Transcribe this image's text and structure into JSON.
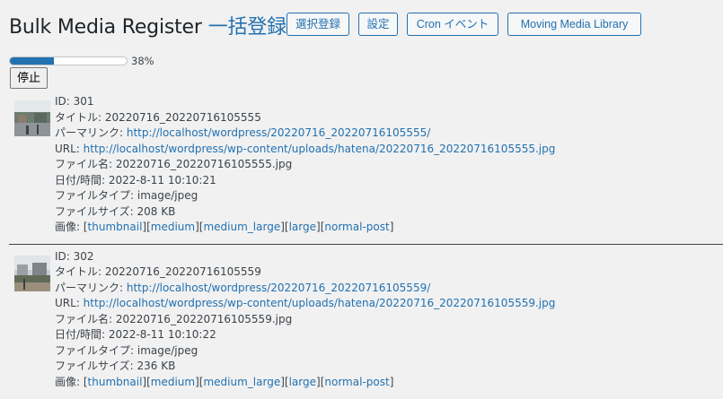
{
  "header": {
    "title": "Bulk Media Register",
    "title_jp": "一括登録",
    "buttons": [
      "選択登録",
      "設定",
      "Cron イベント",
      "Moving Media Library"
    ]
  },
  "progress": {
    "percent": 38,
    "label": "38%"
  },
  "stop_button": "停止",
  "items": [
    {
      "id": "ID: 301",
      "title_label": "タイトル: ",
      "title": "20220716_20220716105555",
      "permalink_label": "パーマリンク: ",
      "permalink": "http://localhost/wordpress/20220716_20220716105555/",
      "url_label": "URL: ",
      "url": "http://localhost/wordpress/wp-content/uploads/hatena/20220716_20220716105555.jpg",
      "filename_label": "ファイル名: ",
      "filename": "20220716_20220716105555.jpg",
      "datetime_label": "日付/時間: ",
      "datetime": "2022-8-11 10:10:21",
      "filetype_label": "ファイルタイプ: ",
      "filetype": "image/jpeg",
      "filesize_label": "ファイルサイズ: ",
      "filesize": "208 KB",
      "images_label": "画像: ",
      "sizes": [
        "thumbnail",
        "medium",
        "medium_large",
        "large",
        "normal-post"
      ]
    },
    {
      "id": "ID: 302",
      "title_label": "タイトル: ",
      "title": "20220716_20220716105559",
      "permalink_label": "パーマリンク: ",
      "permalink": "http://localhost/wordpress/20220716_20220716105559/",
      "url_label": "URL: ",
      "url": "http://localhost/wordpress/wp-content/uploads/hatena/20220716_20220716105559.jpg",
      "filename_label": "ファイル名: ",
      "filename": "20220716_20220716105559.jpg",
      "datetime_label": "日付/時間: ",
      "datetime": "2022-8-11 10:10:22",
      "filetype_label": "ファイルタイプ: ",
      "filetype": "image/jpeg",
      "filesize_label": "ファイルサイズ: ",
      "filesize": "236 KB",
      "images_label": "画像: ",
      "sizes": [
        "thumbnail",
        "medium",
        "medium_large",
        "large",
        "normal-post"
      ]
    }
  ]
}
